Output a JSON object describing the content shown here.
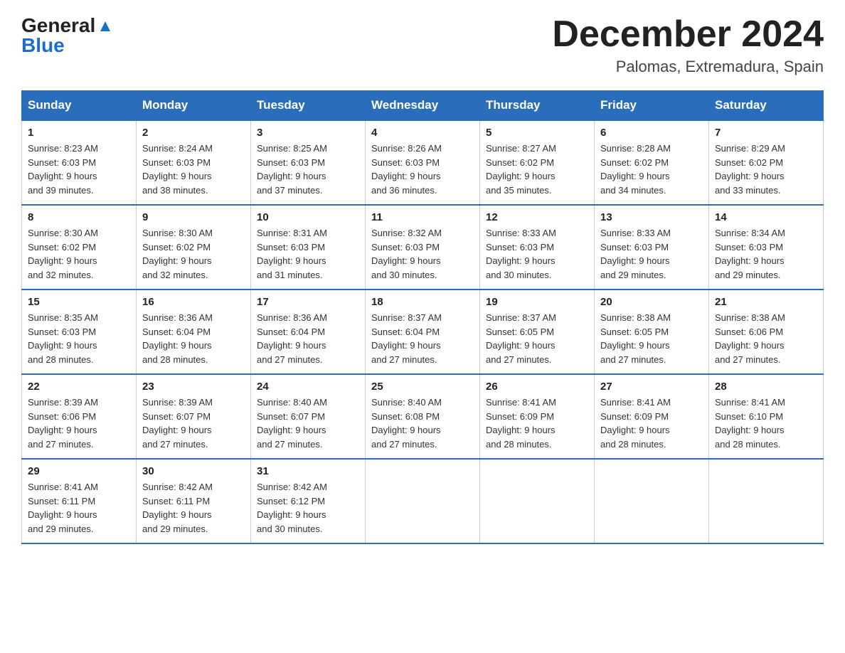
{
  "header": {
    "month_title": "December 2024",
    "location": "Palomas, Extremadura, Spain",
    "logo_general": "General",
    "logo_blue": "Blue"
  },
  "days_of_week": [
    "Sunday",
    "Monday",
    "Tuesday",
    "Wednesday",
    "Thursday",
    "Friday",
    "Saturday"
  ],
  "weeks": [
    [
      {
        "day": "1",
        "sunrise": "8:23 AM",
        "sunset": "6:03 PM",
        "daylight": "9 hours and 39 minutes."
      },
      {
        "day": "2",
        "sunrise": "8:24 AM",
        "sunset": "6:03 PM",
        "daylight": "9 hours and 38 minutes."
      },
      {
        "day": "3",
        "sunrise": "8:25 AM",
        "sunset": "6:03 PM",
        "daylight": "9 hours and 37 minutes."
      },
      {
        "day": "4",
        "sunrise": "8:26 AM",
        "sunset": "6:03 PM",
        "daylight": "9 hours and 36 minutes."
      },
      {
        "day": "5",
        "sunrise": "8:27 AM",
        "sunset": "6:02 PM",
        "daylight": "9 hours and 35 minutes."
      },
      {
        "day": "6",
        "sunrise": "8:28 AM",
        "sunset": "6:02 PM",
        "daylight": "9 hours and 34 minutes."
      },
      {
        "day": "7",
        "sunrise": "8:29 AM",
        "sunset": "6:02 PM",
        "daylight": "9 hours and 33 minutes."
      }
    ],
    [
      {
        "day": "8",
        "sunrise": "8:30 AM",
        "sunset": "6:02 PM",
        "daylight": "9 hours and 32 minutes."
      },
      {
        "day": "9",
        "sunrise": "8:30 AM",
        "sunset": "6:02 PM",
        "daylight": "9 hours and 32 minutes."
      },
      {
        "day": "10",
        "sunrise": "8:31 AM",
        "sunset": "6:03 PM",
        "daylight": "9 hours and 31 minutes."
      },
      {
        "day": "11",
        "sunrise": "8:32 AM",
        "sunset": "6:03 PM",
        "daylight": "9 hours and 30 minutes."
      },
      {
        "day": "12",
        "sunrise": "8:33 AM",
        "sunset": "6:03 PM",
        "daylight": "9 hours and 30 minutes."
      },
      {
        "day": "13",
        "sunrise": "8:33 AM",
        "sunset": "6:03 PM",
        "daylight": "9 hours and 29 minutes."
      },
      {
        "day": "14",
        "sunrise": "8:34 AM",
        "sunset": "6:03 PM",
        "daylight": "9 hours and 29 minutes."
      }
    ],
    [
      {
        "day": "15",
        "sunrise": "8:35 AM",
        "sunset": "6:03 PM",
        "daylight": "9 hours and 28 minutes."
      },
      {
        "day": "16",
        "sunrise": "8:36 AM",
        "sunset": "6:04 PM",
        "daylight": "9 hours and 28 minutes."
      },
      {
        "day": "17",
        "sunrise": "8:36 AM",
        "sunset": "6:04 PM",
        "daylight": "9 hours and 27 minutes."
      },
      {
        "day": "18",
        "sunrise": "8:37 AM",
        "sunset": "6:04 PM",
        "daylight": "9 hours and 27 minutes."
      },
      {
        "day": "19",
        "sunrise": "8:37 AM",
        "sunset": "6:05 PM",
        "daylight": "9 hours and 27 minutes."
      },
      {
        "day": "20",
        "sunrise": "8:38 AM",
        "sunset": "6:05 PM",
        "daylight": "9 hours and 27 minutes."
      },
      {
        "day": "21",
        "sunrise": "8:38 AM",
        "sunset": "6:06 PM",
        "daylight": "9 hours and 27 minutes."
      }
    ],
    [
      {
        "day": "22",
        "sunrise": "8:39 AM",
        "sunset": "6:06 PM",
        "daylight": "9 hours and 27 minutes."
      },
      {
        "day": "23",
        "sunrise": "8:39 AM",
        "sunset": "6:07 PM",
        "daylight": "9 hours and 27 minutes."
      },
      {
        "day": "24",
        "sunrise": "8:40 AM",
        "sunset": "6:07 PM",
        "daylight": "9 hours and 27 minutes."
      },
      {
        "day": "25",
        "sunrise": "8:40 AM",
        "sunset": "6:08 PM",
        "daylight": "9 hours and 27 minutes."
      },
      {
        "day": "26",
        "sunrise": "8:41 AM",
        "sunset": "6:09 PM",
        "daylight": "9 hours and 28 minutes."
      },
      {
        "day": "27",
        "sunrise": "8:41 AM",
        "sunset": "6:09 PM",
        "daylight": "9 hours and 28 minutes."
      },
      {
        "day": "28",
        "sunrise": "8:41 AM",
        "sunset": "6:10 PM",
        "daylight": "9 hours and 28 minutes."
      }
    ],
    [
      {
        "day": "29",
        "sunrise": "8:41 AM",
        "sunset": "6:11 PM",
        "daylight": "9 hours and 29 minutes."
      },
      {
        "day": "30",
        "sunrise": "8:42 AM",
        "sunset": "6:11 PM",
        "daylight": "9 hours and 29 minutes."
      },
      {
        "day": "31",
        "sunrise": "8:42 AM",
        "sunset": "6:12 PM",
        "daylight": "9 hours and 30 minutes."
      },
      null,
      null,
      null,
      null
    ]
  ],
  "labels": {
    "sunrise": "Sunrise:",
    "sunset": "Sunset:",
    "daylight": "Daylight:"
  }
}
